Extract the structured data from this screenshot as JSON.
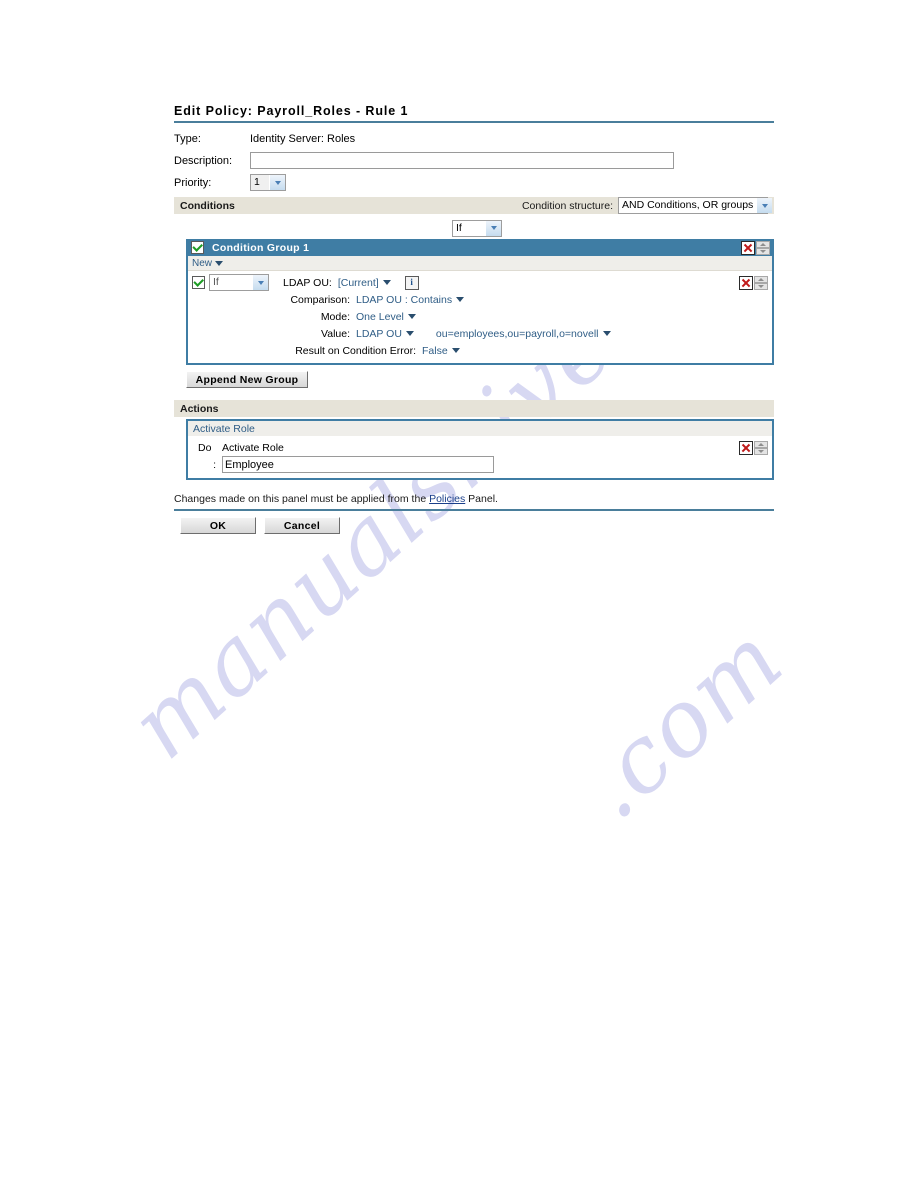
{
  "watermark": {
    "line1": "manualshive",
    "line2": ".com"
  },
  "page_title": "Edit Policy: Payroll_Roles - Rule 1",
  "form": {
    "type_label": "Type:",
    "type_value": "Identity Server: Roles",
    "description_label": "Description:",
    "description_value": "",
    "description_placeholder": "",
    "priority_label": "Priority:",
    "priority_value": "1"
  },
  "conditions": {
    "section_title": "Conditions",
    "structure_label": "Condition structure:",
    "structure_value": "AND Conditions, OR groups",
    "toplevel_if": "If",
    "group": {
      "title": "Condition Group 1",
      "new_label": "New",
      "row_if": "If",
      "ldap_ou_label": "LDAP OU:",
      "ldap_ou_value": "[Current]",
      "info_glyph": "i",
      "comparison_label": "Comparison:",
      "comparison_value": "LDAP OU : Contains",
      "mode_label": "Mode:",
      "mode_value": "One Level",
      "value_label": "Value:",
      "value_source": "LDAP OU",
      "value_data": "ou=employees,ou=payroll,o=novell",
      "error_label": "Result on Condition Error:",
      "error_value": "False"
    },
    "append_button": "Append New Group"
  },
  "actions": {
    "section_title": "Actions",
    "panel_title": "Activate Role",
    "do_label": "Do",
    "action_name": "Activate Role",
    "colon": ":",
    "role_value": "Employee"
  },
  "footer": {
    "note_before": "Changes made on this panel must be applied from the ",
    "note_link": "Policies",
    "note_after": " Panel.",
    "ok_label": "OK",
    "cancel_label": "Cancel"
  },
  "colors": {
    "accent_blue": "#3f7da4",
    "rule_blue": "#4a7e9b",
    "section_bar": "#e6e3d8",
    "link_blue": "#2f5d86",
    "delete_red": "#c01a1a",
    "check_green": "#1c9c23",
    "watermark": "#d7d8f2"
  }
}
